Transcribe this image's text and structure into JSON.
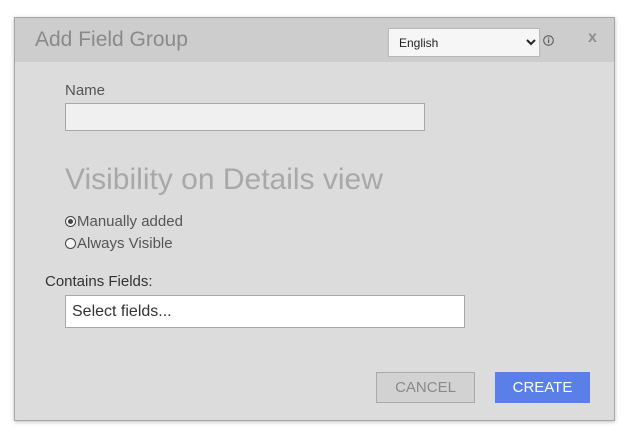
{
  "dialog": {
    "title": "Add Field Group",
    "close_label": "x",
    "language": {
      "selected": "English",
      "info_icon": "info-icon"
    }
  },
  "form": {
    "name_label": "Name",
    "name_value": "",
    "visibility_heading": "Visibility on Details view",
    "visibility_options": [
      {
        "label": "Manually added",
        "checked": true
      },
      {
        "label": "Always Visible",
        "checked": false
      }
    ],
    "contains_fields_label": "Contains Fields:",
    "fields_placeholder": "Select fields..."
  },
  "buttons": {
    "cancel": "CANCEL",
    "create": "CREATE"
  },
  "colors": {
    "primary": "#5a7fe6",
    "dialog_bg": "#dcdcdc",
    "titlebar_bg": "#cdcdcd"
  }
}
